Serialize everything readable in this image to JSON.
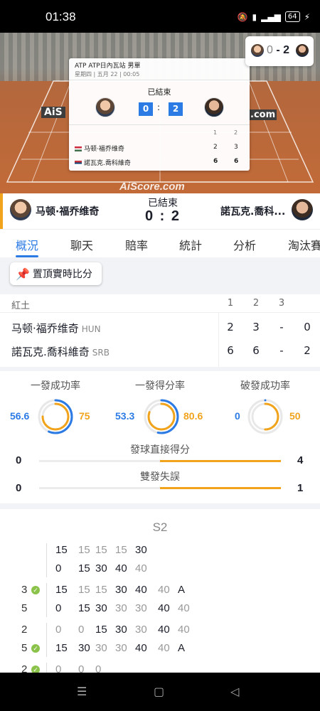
{
  "status_bar": {
    "time": "01:38",
    "battery": "64"
  },
  "court": {
    "watermark": "AiScore.com",
    "brand_left": "AiS",
    "brand_right": ".com"
  },
  "score_card": {
    "title": "ATP ATP日內瓦站 男單",
    "subtitle": "星期四 | 五月 22 | 00:05",
    "status": "已結束",
    "score_left": "0",
    "score_right": "2",
    "colon": ":",
    "set_headers": [
      "1",
      "2"
    ],
    "rows": [
      {
        "name": "马顿·福乔维奇",
        "s1": "2",
        "s2": "3"
      },
      {
        "name": "諾瓦克.喬科維奇",
        "s1": "6",
        "s2": "6"
      }
    ]
  },
  "mini_score": {
    "left": "0",
    "sep": "-",
    "right": "2"
  },
  "match_bar": {
    "status": "已結束",
    "score": "0 : 2",
    "home": "马顿·福乔维奇",
    "away": "諾瓦克.喬科..."
  },
  "tabs": [
    "概況",
    "聊天",
    "賠率",
    "統計",
    "分析",
    "淘汰賽"
  ],
  "pin_button": "置頂實時比分",
  "score_table": {
    "surface": "紅土",
    "headers": [
      "1",
      "2",
      "3"
    ],
    "rows": [
      {
        "name": "马顿·福乔维奇",
        "country": "HUN",
        "s1": "2",
        "s2": "3",
        "s3": "-",
        "total": "0"
      },
      {
        "name": "諾瓦克.喬科維奇",
        "country": "SRB",
        "s1": "6",
        "s2": "6",
        "s3": "-",
        "total": "2"
      }
    ]
  },
  "stats": {
    "rings": [
      {
        "label": "一發成功率",
        "home": "56.6",
        "away": "75",
        "home_pct": 56.6,
        "away_pct": 75
      },
      {
        "label": "一發得分率",
        "home": "53.3",
        "away": "80.6",
        "home_pct": 53.3,
        "away_pct": 80.6
      },
      {
        "label": "破發成功率",
        "home": "0",
        "away": "50",
        "home_pct": 0,
        "away_pct": 50
      }
    ],
    "bars": [
      {
        "label": "發球直接得分",
        "home": "0",
        "away": "4",
        "away_fraction": 1.0
      },
      {
        "label": "雙發失誤",
        "home": "0",
        "away": "1",
        "away_fraction": 1.0
      }
    ]
  },
  "point_by_point": {
    "set_title": "S2",
    "games": [
      {
        "counter": "",
        "check": false,
        "top": [
          "15",
          "15",
          "15",
          "15",
          "30"
        ],
        "top_gray": [
          false,
          true,
          true,
          true,
          false
        ],
        "bottom": [
          "0",
          "15",
          "30",
          "40",
          "40"
        ],
        "bottom_gray": [
          false,
          false,
          false,
          false,
          true
        ]
      },
      {
        "counter": "3",
        "check": true,
        "top": [
          "15",
          "15",
          "15",
          "30",
          "40",
          "40",
          "A"
        ],
        "top_gray": [
          false,
          true,
          true,
          false,
          false,
          true,
          false
        ],
        "counter2": "5",
        "bottom": [
          "0",
          "15",
          "30",
          "30",
          "30",
          "40",
          "40"
        ],
        "bottom_gray": [
          false,
          false,
          false,
          true,
          true,
          false,
          true
        ]
      },
      {
        "counter": "2",
        "check": false,
        "top": [
          "0",
          "0",
          "15",
          "30",
          "30",
          "40",
          "40"
        ],
        "top_gray": [
          true,
          true,
          false,
          false,
          true,
          false,
          true
        ],
        "counter2": "5",
        "check2": true,
        "bottom": [
          "15",
          "30",
          "30",
          "30",
          "40",
          "40",
          "A"
        ],
        "bottom_gray": [
          false,
          false,
          true,
          true,
          false,
          true,
          false
        ]
      },
      {
        "counter": "2",
        "check": true,
        "top": [
          "0",
          "0",
          "0"
        ],
        "top_gray": [
          true,
          true,
          true
        ]
      }
    ]
  },
  "colors": {
    "accent": "#2c7be5",
    "orange": "#f0a31b",
    "green": "#8bc34a"
  }
}
